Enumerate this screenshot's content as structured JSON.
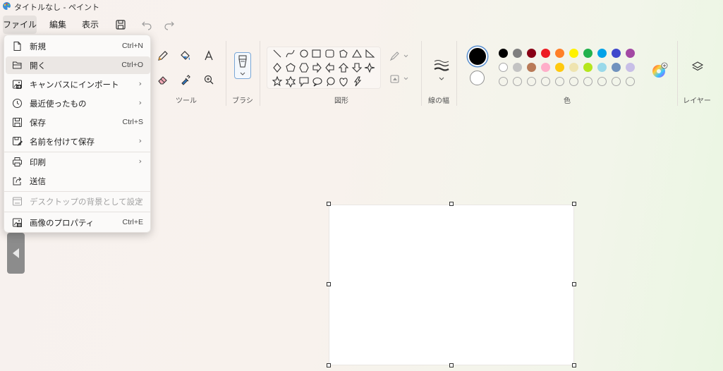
{
  "window": {
    "title": "タイトルなし - ペイント"
  },
  "menubar": {
    "file": "ファイル",
    "edit": "編集",
    "view": "表示"
  },
  "ribbon": {
    "tools_label": "ツール",
    "brush_label": "ブラシ",
    "shapes_label": "図形",
    "stroke_label": "線の幅",
    "colors_label": "色",
    "layers_label": "レイヤー",
    "primary_color": "#000000",
    "secondary_color": "#ffffff",
    "palette_row1": [
      "#000000",
      "#7f7f7f",
      "#880015",
      "#ed1c24",
      "#ff7f27",
      "#fff200",
      "#22b14c",
      "#00a2e8",
      "#3f48cc",
      "#a349a4"
    ],
    "palette_row2": [
      "#ffffff",
      "#c3c3c3",
      "#b97a57",
      "#ffaec9",
      "#ffc90e",
      "#efe4b0",
      "#b5e61d",
      "#99d9ea",
      "#7092be",
      "#c8bfe7"
    ]
  },
  "file_menu": {
    "items": [
      {
        "label": "新規",
        "shortcut": "Ctrl+N",
        "icon": "new-file-icon"
      },
      {
        "label": "開く",
        "shortcut": "Ctrl+O",
        "icon": "folder-open-icon"
      },
      {
        "label": "キャンバスにインポート",
        "shortcut": "",
        "icon": "import-image-icon"
      },
      {
        "label": "最近使ったもの",
        "shortcut": "",
        "icon": "clock-icon"
      },
      {
        "label": "保存",
        "shortcut": "Ctrl+S",
        "icon": "save-icon"
      },
      {
        "label": "名前を付けて保存",
        "shortcut": "",
        "icon": "save-as-icon"
      },
      {
        "label": "印刷",
        "shortcut": "",
        "icon": "printer-icon"
      },
      {
        "label": "送信",
        "shortcut": "",
        "icon": "share-icon"
      },
      {
        "label": "デスクトップの背景として設定",
        "shortcut": "",
        "icon": "desktop-background-icon"
      },
      {
        "label": "画像のプロパティ",
        "shortcut": "Ctrl+E",
        "icon": "image-properties-icon"
      }
    ]
  }
}
